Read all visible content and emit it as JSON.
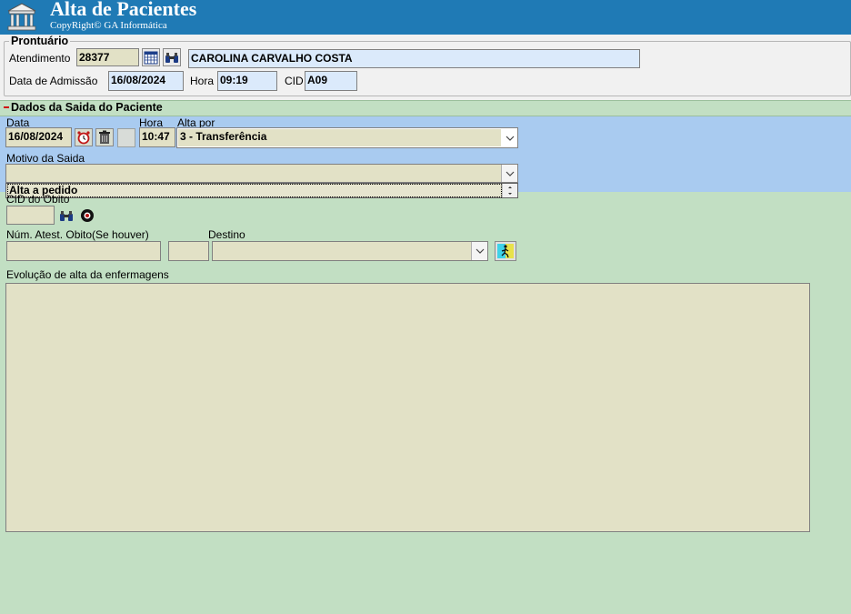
{
  "header": {
    "title": "Alta de Pacientes",
    "subtitle": "CopyRight© GA Informática",
    "logo_icon": "building-columns-icon",
    "bg_color": "#1f7ab5"
  },
  "prontuario": {
    "legend": "Prontuário",
    "atendimento_label": "Atendimento",
    "atendimento_value": "28377",
    "patient_name": "CAROLINA CARVALHO COSTA",
    "admissao_label": "Data de Admissão",
    "admissao_value": "16/08/2024",
    "hora_label": "Hora",
    "hora_value": "09:19",
    "cid_label": "CID",
    "cid_value": "A09"
  },
  "saida": {
    "section_title": "Dados da Saida do Paciente",
    "data_label": "Data",
    "data_value": "16/08/2024",
    "hora_label": "Hora",
    "hora_value": "10:47",
    "alta_por_label": "Alta por",
    "alta_por_value": "3 - Transferência",
    "motivo_label": "Motivo da Saida",
    "motivo_value": "",
    "motivo_list_item": "Alta a pedido",
    "cid_obito_label": "CID do Obito",
    "cid_obito_value": "",
    "atestado_label": "Núm. Atest. Obito(Se houver)",
    "atestado_value": "",
    "atestado_extra_value": "",
    "destino_label": "Destino",
    "destino_value": "",
    "evolucao_label": "Evolução de alta da enfermagens",
    "evolucao_value": ""
  },
  "colors": {
    "body_bg": "#c2dfc3",
    "band_bg": "#a9cbf0",
    "field_bg": "#e2e1c6",
    "field_blue": "#dbeafb"
  }
}
